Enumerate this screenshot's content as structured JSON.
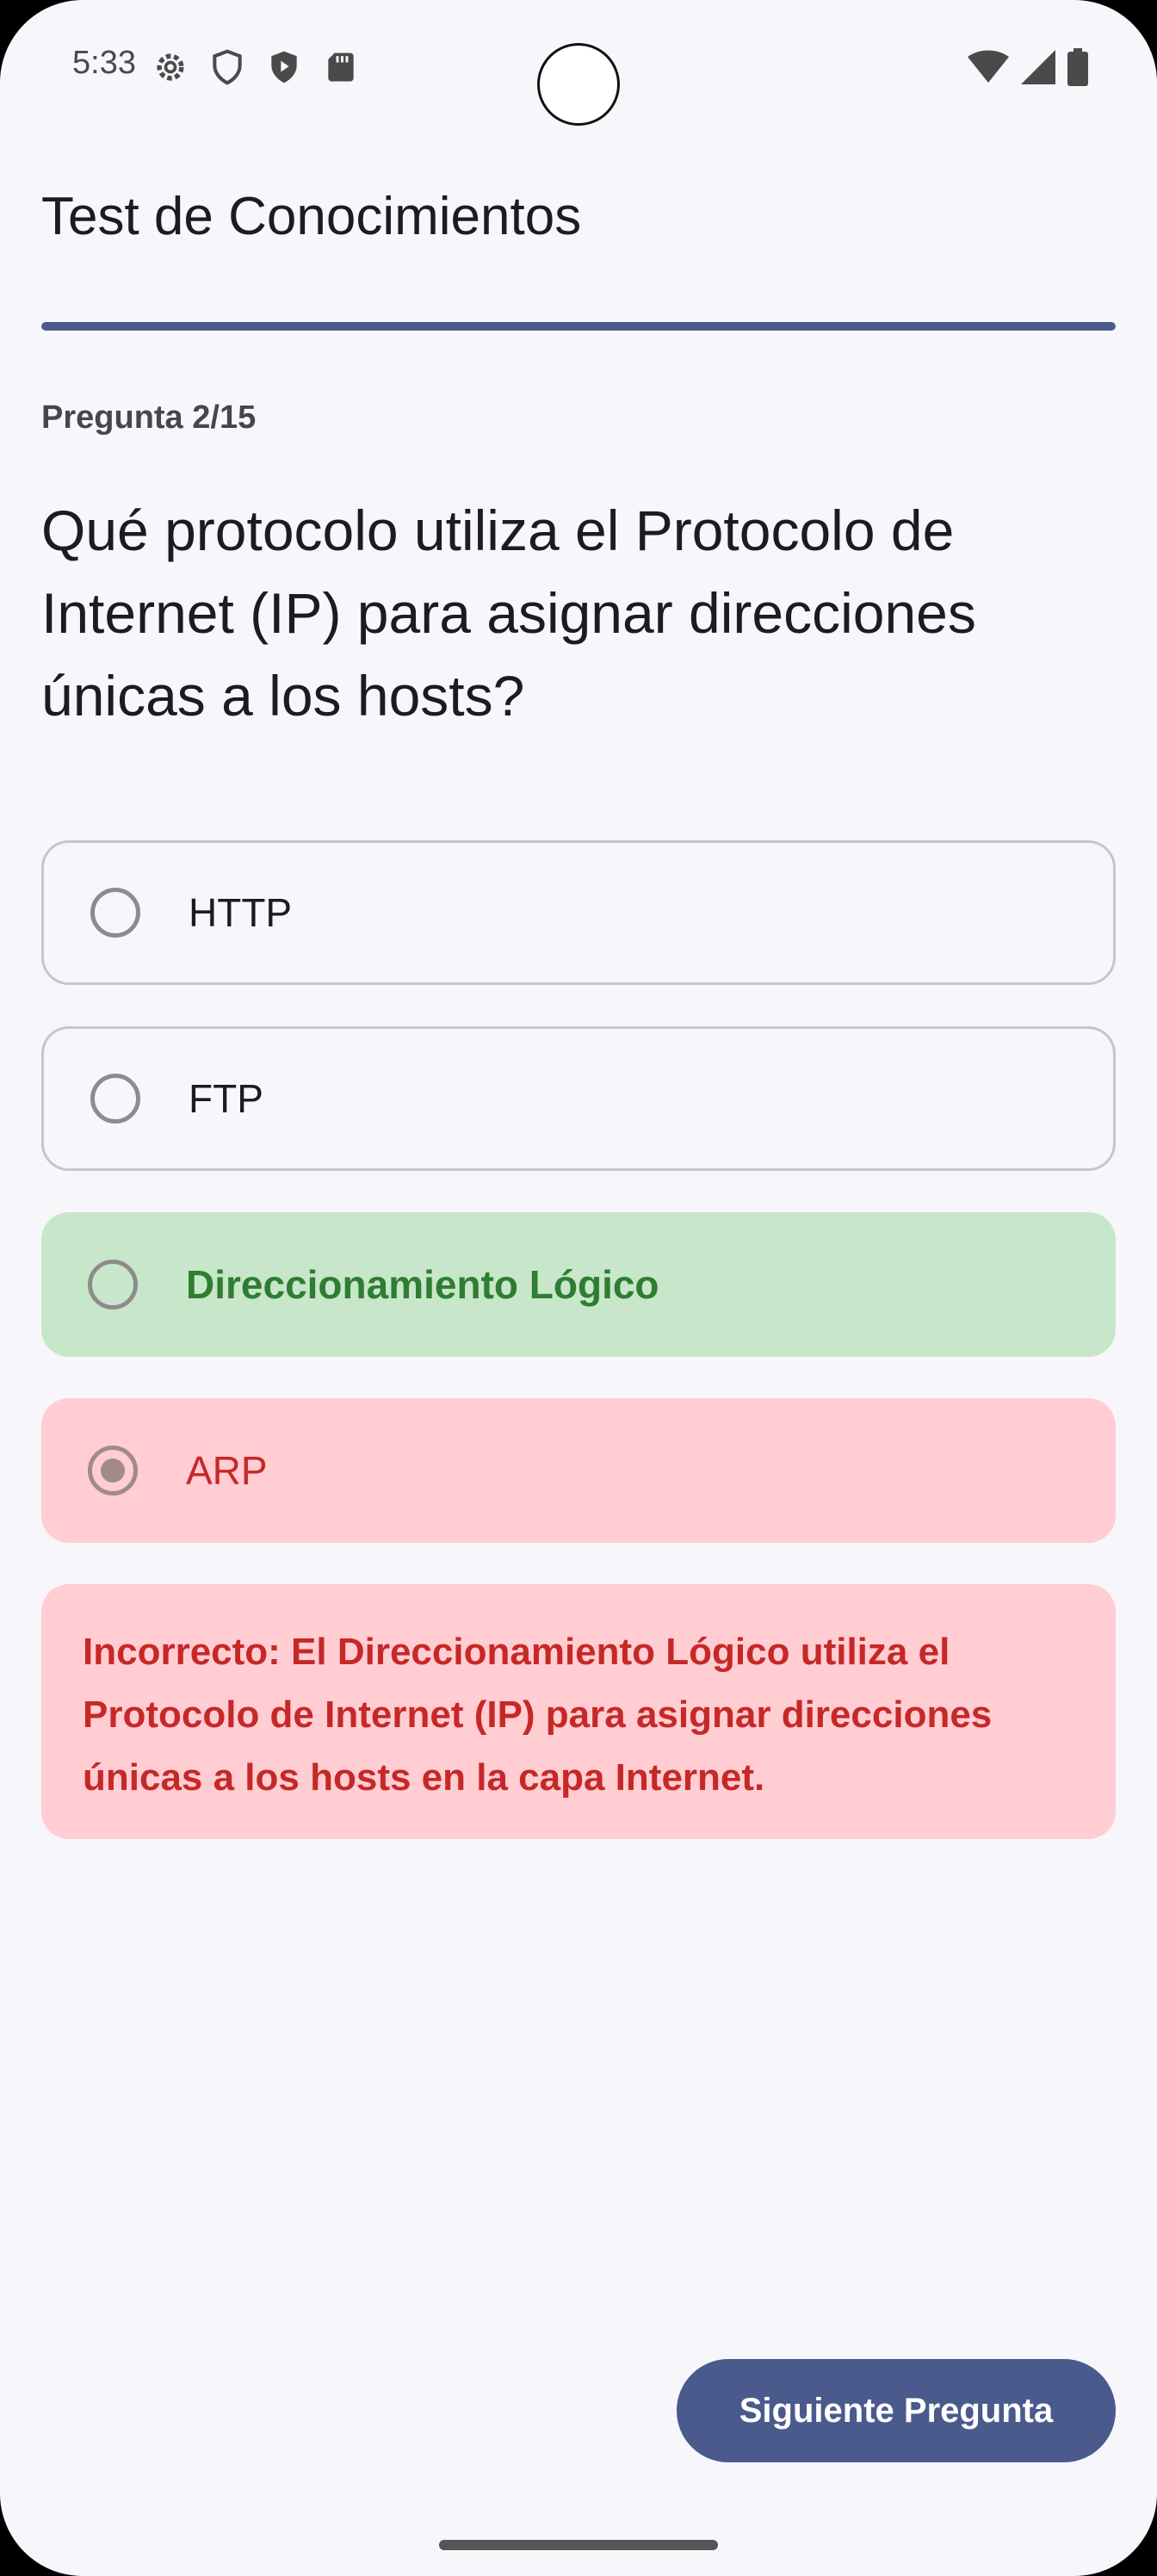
{
  "status_bar": {
    "time": "5:33",
    "left_icons": [
      "gear-icon",
      "shield-icon",
      "play-shield-icon",
      "sd-card-icon"
    ],
    "right_icons": [
      "wifi-icon",
      "signal-icon",
      "battery-icon"
    ]
  },
  "app": {
    "title": "Test de Conocimientos",
    "progress_fraction": 1.0
  },
  "quiz": {
    "counter": "Pregunta 2/15",
    "question": "Qué protocolo utiliza el Protocolo de Internet (IP) para asignar direcciones únicas a los hosts?",
    "options": [
      {
        "label": "HTTP",
        "state": "neutral",
        "selected": false
      },
      {
        "label": "FTP",
        "state": "neutral",
        "selected": false
      },
      {
        "label": "Direccionamiento Lógico",
        "state": "correct",
        "selected": false
      },
      {
        "label": "ARP",
        "state": "wrong",
        "selected": true
      }
    ],
    "feedback": "Incorrecto: El Direccionamiento Lógico utiliza el Protocolo de Internet (IP) para asignar direcciones únicas a los hosts en la capa Internet.",
    "next_label": "Siguiente Pregunta"
  },
  "colors": {
    "primary": "#4a5a8c",
    "correct_bg": "#c8e6c9",
    "correct_text": "#2e7d32",
    "wrong_bg": "#ffcdd2",
    "wrong_text": "#c62828"
  }
}
